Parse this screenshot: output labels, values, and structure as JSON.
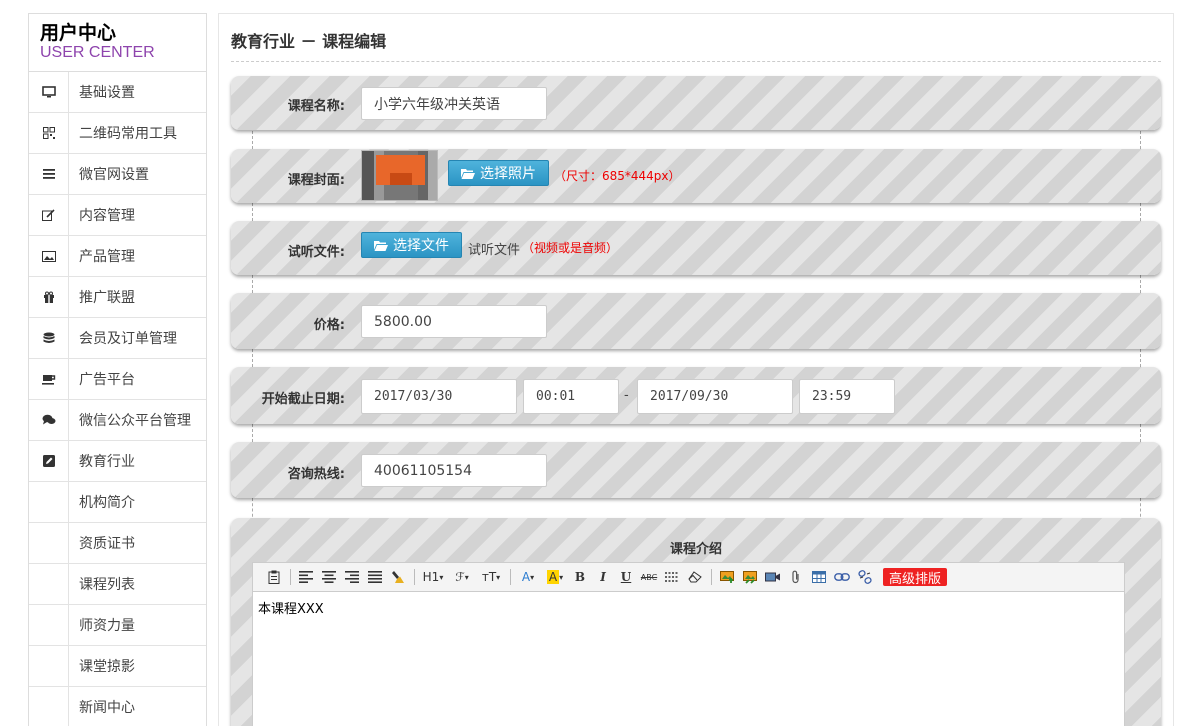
{
  "brand": {
    "title": "用户中心",
    "subtitle": "USER CENTER"
  },
  "sidebar": {
    "items": [
      {
        "label": "基础设置",
        "icon": "monitor-icon"
      },
      {
        "label": "二维码常用工具",
        "icon": "qrcode-icon"
      },
      {
        "label": "微官网设置",
        "icon": "list-icon"
      },
      {
        "label": "内容管理",
        "icon": "edit-icon"
      },
      {
        "label": "产品管理",
        "icon": "picture-icon"
      },
      {
        "label": "推广联盟",
        "icon": "gift-icon"
      },
      {
        "label": "会员及订单管理",
        "icon": "database-icon"
      },
      {
        "label": "广告平台",
        "icon": "coffee-icon"
      },
      {
        "label": "微信公众平台管理",
        "icon": "comments-icon"
      },
      {
        "label": "教育行业",
        "icon": "pencil-square-icon"
      }
    ],
    "subitems": [
      "机构简介",
      "资质证书",
      "课程列表",
      "师资力量",
      "课堂掠影",
      "新闻中心"
    ]
  },
  "page": {
    "title": "教育行业 － 课程编辑"
  },
  "form": {
    "course_name": {
      "label": "课程名称:",
      "value": "小学六年级冲关英语"
    },
    "cover": {
      "label": "课程封面:",
      "button": "选择照片",
      "hint": "（尺寸：685*444px）"
    },
    "trial": {
      "label": "试听文件:",
      "button": "选择文件",
      "filename": "试听文件",
      "hint": "（视频或是音频）"
    },
    "price": {
      "label": "价格:",
      "value": "5800.00"
    },
    "dates": {
      "label": "开始截止日期:",
      "start_date": "2017/03/30",
      "start_time": "00:01",
      "separator": "-",
      "end_date": "2017/09/30",
      "end_time": "23:59"
    },
    "hotline": {
      "label": "咨询热线:",
      "value": "40061105154"
    }
  },
  "editor": {
    "title": "课程介绍",
    "toolbar": {
      "h1": "H1",
      "font": "ℱ",
      "size": "тT",
      "font_color": "A",
      "bg_color": "A",
      "bold": "B",
      "italic": "I",
      "underline": "U",
      "strike": "ABC",
      "advanced": "高级排版"
    },
    "content": "本课程XXX"
  },
  "colors": {
    "accent": "#2b94c4",
    "brand_sub": "#8e44ad",
    "hint": "#ee0000",
    "advanced": "#ee2222"
  }
}
